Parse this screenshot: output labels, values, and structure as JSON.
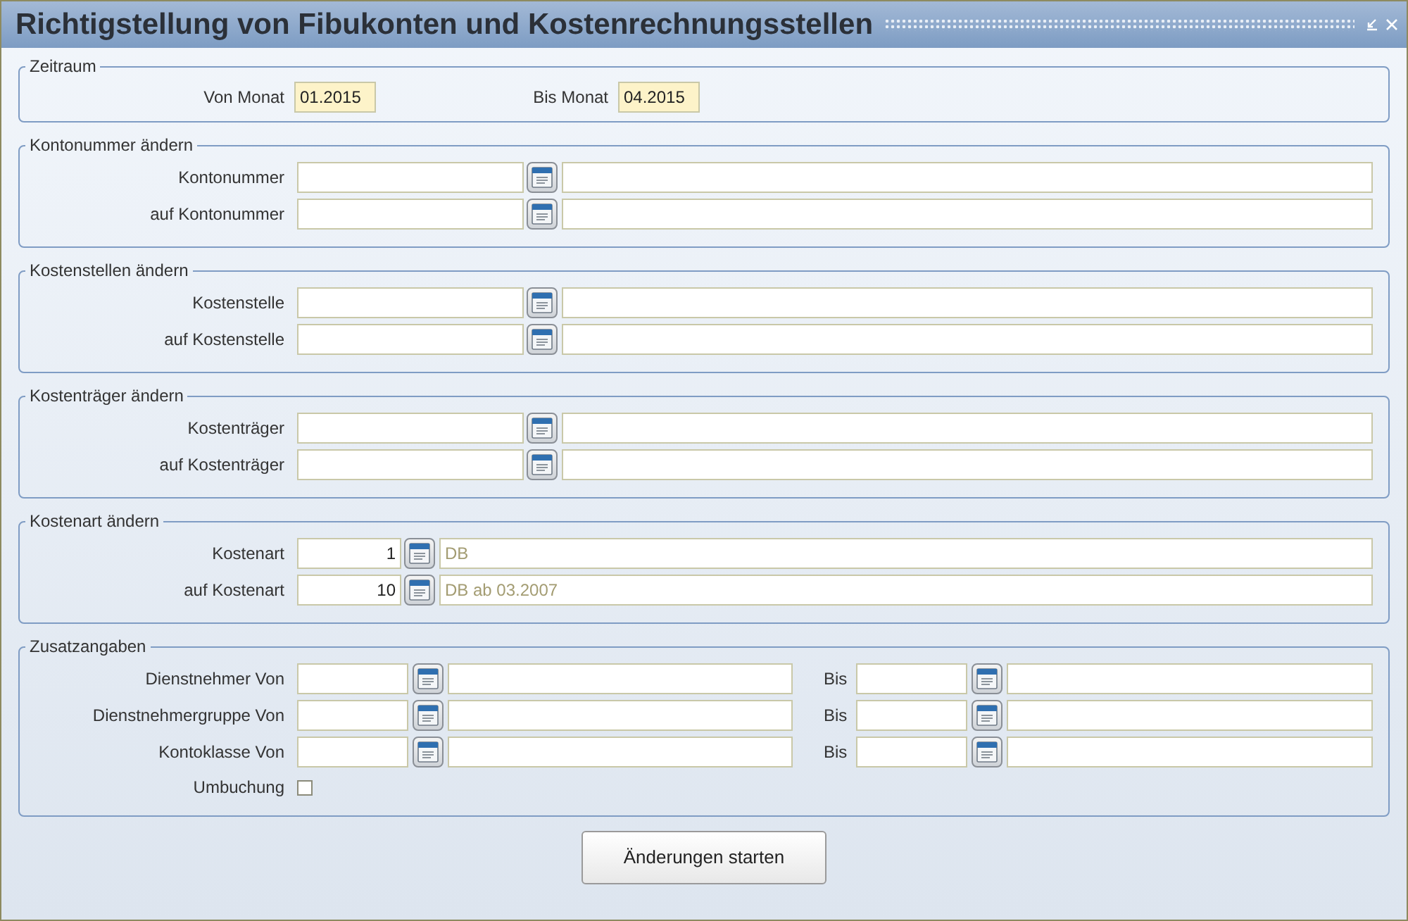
{
  "window": {
    "title": "Richtigstellung von Fibukonten und Kostenrechnungsstellen"
  },
  "sections": [
    {
      "kind": "period",
      "legend": "Zeitraum",
      "fields": [
        {
          "label": "Von Monat",
          "value": "01.2015"
        },
        {
          "label": "Bis Monat",
          "value": "04.2015"
        }
      ]
    },
    {
      "kind": "lookup",
      "legend": "Kontonummer ändern",
      "rows": [
        {
          "label": "Kontonummer"
        },
        {
          "label": "auf Kontonummer"
        }
      ]
    },
    {
      "kind": "lookup",
      "legend": "Kostenstellen ändern",
      "rows": [
        {
          "label": "Kostenstelle"
        },
        {
          "label": "auf Kostenstelle"
        }
      ]
    },
    {
      "kind": "lookup",
      "legend": "Kostenträger ändern",
      "rows": [
        {
          "label": "Kostenträger"
        },
        {
          "label": "auf Kostenträger"
        }
      ]
    },
    {
      "kind": "code",
      "legend": "Kostenart ändern",
      "rows": [
        {
          "label": "Kostenart",
          "code": "1",
          "description": "DB"
        },
        {
          "label": "auf Kostenart",
          "code": "10",
          "description": "DB ab 03.2007"
        }
      ]
    },
    {
      "kind": "range",
      "legend": "Zusatzangaben",
      "rows": [
        {
          "label": "Dienstnehmer Von",
          "to_label": "Bis"
        },
        {
          "label": "Dienstnehmergruppe Von",
          "to_label": "Bis"
        },
        {
          "label": "Kontoklasse Von",
          "to_label": "Bis"
        }
      ],
      "checkbox": {
        "label": "Umbuchung",
        "checked": false
      }
    }
  ],
  "button": "Änderungen starten"
}
